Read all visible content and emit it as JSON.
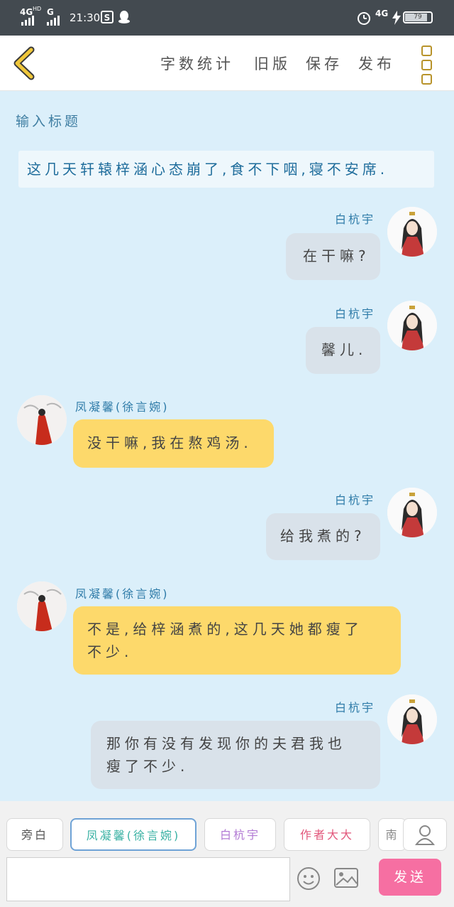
{
  "status_bar": {
    "network1": "4G",
    "network1_sup": "HD",
    "network2": "G",
    "time": "21:30",
    "net_right": "4G",
    "battery": "79"
  },
  "toolbar": {
    "word_count": "字数统计",
    "old_version": "旧版",
    "save": "保存",
    "publish": "发布"
  },
  "title_placeholder": "输入标题",
  "narration": "这几天轩辕梓涵心态崩了,食不下咽,寝不安席.",
  "messages": [
    {
      "speaker": "白杭宇",
      "text": "在干嘛?"
    },
    {
      "speaker": "白杭宇",
      "text": "馨儿."
    },
    {
      "speaker": "凤凝馨(徐言婉)",
      "text": "没干嘛,我在熬鸡汤."
    },
    {
      "speaker": "白杭宇",
      "text": "给我煮的?"
    },
    {
      "speaker": "凤凝馨(徐言婉)",
      "text_line1": "不是,给梓涵煮的,这几天她都瘦了",
      "text_line2": "不少."
    },
    {
      "speaker": "白杭宇",
      "text_line1": "那你有没有发现你的夫君我也",
      "text_line2": "瘦了不少."
    }
  ],
  "roles": [
    {
      "label": "旁白",
      "color": "#555555"
    },
    {
      "label": "凤凝馨(徐言婉)",
      "color": "#39b1a3"
    },
    {
      "label": "白杭宇",
      "color": "#b27ad4"
    },
    {
      "label": "作者大大",
      "color": "#e2577b"
    },
    {
      "label": "南",
      "color": "#888888"
    }
  ],
  "send_label": "发送",
  "colors": {
    "accent": "#f66fa2",
    "bubble_gray": "#d9e2ea",
    "bubble_yellow": "#fdd96b",
    "chat_bg": "#dbeffa"
  }
}
